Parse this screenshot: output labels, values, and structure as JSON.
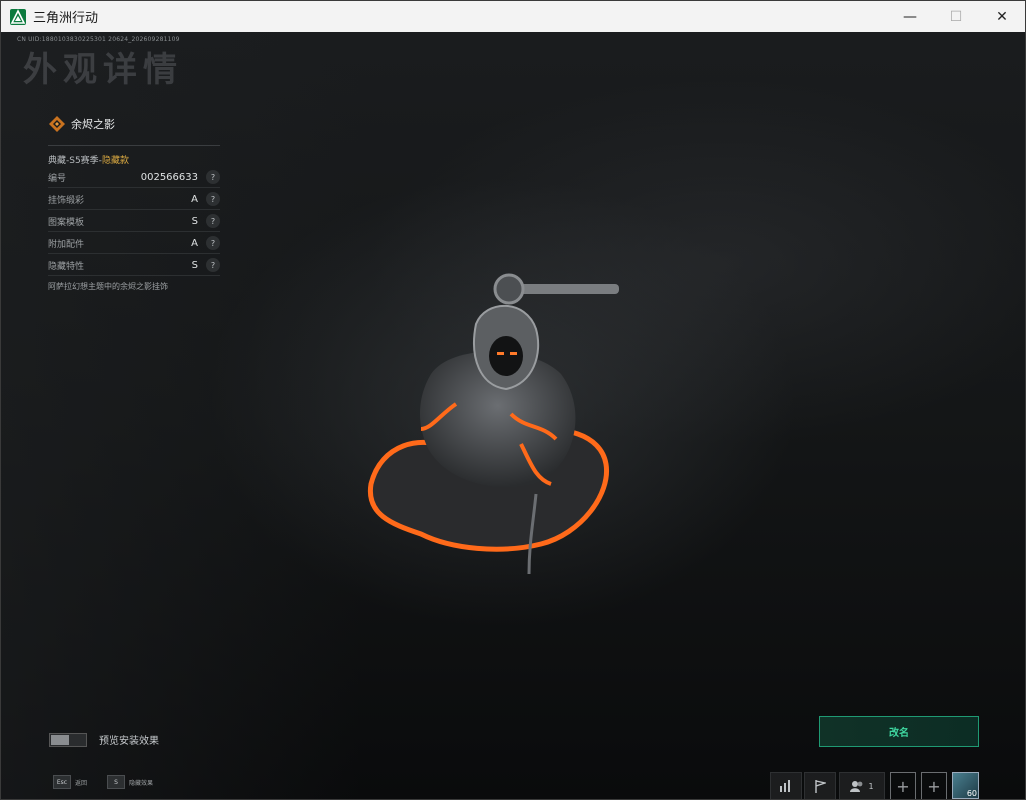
{
  "window": {
    "title": "三角洲行动",
    "minimize": "—",
    "maximize": "☐",
    "close": "✕"
  },
  "header": {
    "uid": "CN UID:1880103830225301 20624_202609281109",
    "page_title": "外观详情"
  },
  "item": {
    "name": "余烬之影",
    "series_prefix": "典藏-S5赛季-",
    "series_tag": "隐藏款",
    "attributes": [
      {
        "label": "编号",
        "value": "002566633"
      },
      {
        "label": "挂饰缎彩",
        "value": "A"
      },
      {
        "label": "图案模板",
        "value": "S"
      },
      {
        "label": "附加配件",
        "value": "A"
      },
      {
        "label": "隐藏特性",
        "value": "S"
      }
    ],
    "help_symbol": "?",
    "description": "阿萨拉幻想主题中的余烬之影挂饰"
  },
  "preview": {
    "label": "预览安装效果",
    "enabled": false
  },
  "rename_button": "改名",
  "hints": [
    {
      "key": "Esc",
      "label": "返回"
    },
    {
      "key": "S",
      "label": "隐藏效果"
    }
  ],
  "hud": {
    "friends_count": "1",
    "plus": "+",
    "avatar_level": "60"
  },
  "colors": {
    "accent_green": "#3fd6a0",
    "hidden_gold": "#d6a640",
    "ember_orange": "#ff6a1a"
  }
}
